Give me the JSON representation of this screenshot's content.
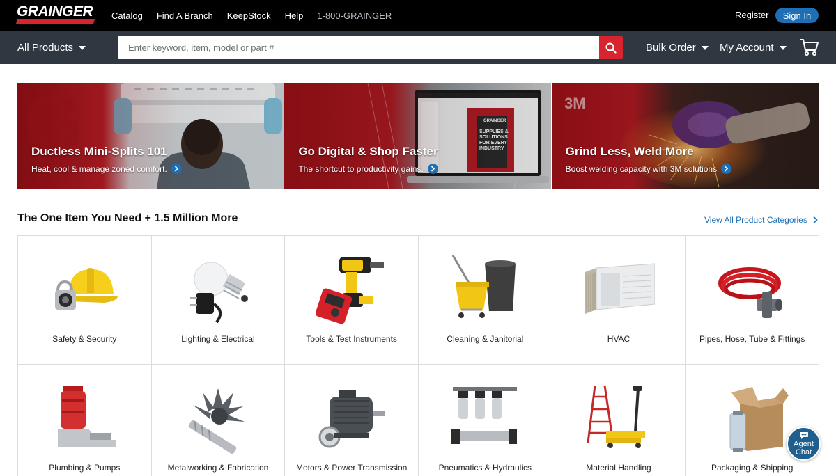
{
  "topbar": {
    "logo": "GRAINGER",
    "nav": [
      "Catalog",
      "Find A Branch",
      "KeepStock",
      "Help"
    ],
    "phone": "1-800-GRAINGER",
    "register": "Register",
    "sign_in": "Sign In"
  },
  "searchbar": {
    "all_products": "All Products",
    "placeholder": "Enter keyword, item, model or part #",
    "bulk_order": "Bulk Order",
    "my_account": "My Account"
  },
  "banners": [
    {
      "title": "Ductless Mini-Splits 101",
      "subtitle": "Heat, cool & manage zoned comfort."
    },
    {
      "title": "Go Digital & Shop Faster",
      "subtitle": "The shortcut to productivity gains."
    },
    {
      "title": "Grind Less, Weld More",
      "subtitle": "Boost welding capacity with 3M solutions",
      "brand": "3M"
    }
  ],
  "section": {
    "title": "The One Item You Need + 1.5 Million More",
    "view_all": "View All Product Categories"
  },
  "categories": [
    "Safety & Security",
    "Lighting & Electrical",
    "Tools & Test Instruments",
    "Cleaning & Janitorial",
    "HVAC",
    "Pipes, Hose, Tube & Fittings",
    "Plumbing & Pumps",
    "Metalworking & Fabrication",
    "Motors & Power Transmission",
    "Pneumatics & Hydraulics",
    "Material Handling",
    "Packaging & Shipping"
  ],
  "chat": {
    "line1": "Agent",
    "line2": "Chat"
  },
  "colors": {
    "brand_red": "#d8242e",
    "link_blue": "#1f6fb5",
    "nav_dark": "#2f3840"
  }
}
